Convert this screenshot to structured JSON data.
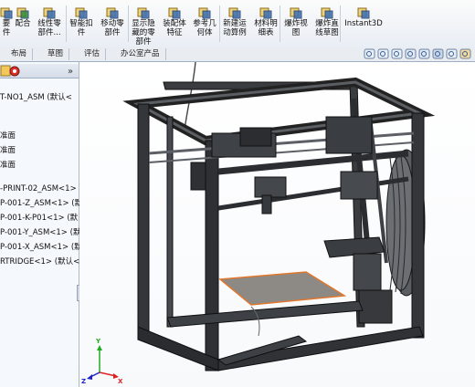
{
  "toolbar": {
    "buttons": [
      {
        "label": "要\n件",
        "icon": "insert-component-icon"
      },
      {
        "label": "配合",
        "icon": "mate-icon"
      },
      {
        "label": "线性零\n部件...",
        "icon": "linear-pattern-icon"
      },
      {
        "label": "智能扣\n件",
        "icon": "smart-fasteners-icon"
      },
      {
        "label": "移动零\n部件",
        "icon": "move-component-icon"
      },
      {
        "label": "显示隐\n藏的零\n部件",
        "icon": "show-hidden-icon"
      },
      {
        "label": "装配体\n特征",
        "icon": "assembly-features-icon"
      },
      {
        "label": "参考几\n何体",
        "icon": "reference-geometry-icon"
      },
      {
        "label": "新建运\n动算例",
        "icon": "new-motion-study-icon"
      },
      {
        "label": "材料明\n细表",
        "icon": "bill-of-materials-icon"
      },
      {
        "label": "爆炸视\n图",
        "icon": "exploded-view-icon"
      },
      {
        "label": "爆炸直\n线草图",
        "icon": "explode-line-sketch-icon"
      },
      {
        "label": "Instant3D",
        "icon": "instant3d-icon"
      }
    ]
  },
  "tabs": [
    "布局",
    "草图",
    "评估",
    "办公室产品"
  ],
  "view_tools": [
    "zoom-to-fit-icon",
    "zoom-area-icon",
    "previous-view-icon",
    "section-view-icon",
    "view-orientation-icon",
    "display-style-icon",
    "hide-show-icon",
    "edit-appearance-icon"
  ],
  "tree": {
    "items": [
      "T-NO1_ASM  (默认<",
      "准面",
      "准面",
      "准面",
      "-PRINT-02_ASM<1>",
      "P-001-Z_ASM<1>  (默",
      "P-001-K-P01<1>  (默",
      "P-001-Y_ASM<1>  (默",
      "P-001-X_ASM<1>  (默",
      "RTRIDGE<1>  (默认<"
    ],
    "collapse_glyph": "»"
  },
  "axes": {
    "x": "X",
    "y": "Y",
    "z": "Z"
  },
  "colors": {
    "frame": "#2d2f33",
    "frame_edge": "#111214",
    "bed": "#8d8a86",
    "bed_edge": "#e0772e",
    "axis_x": "#d22",
    "axis_y": "#2a2",
    "axis_z": "#22c"
  }
}
